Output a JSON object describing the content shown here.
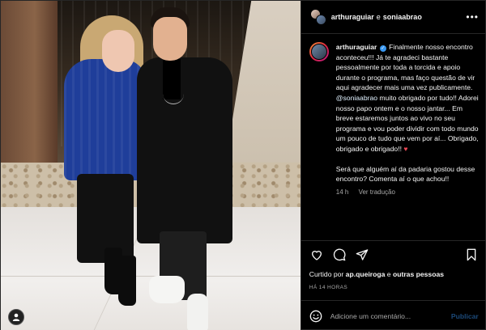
{
  "header": {
    "user1": "arthuraguiar",
    "connector": "e",
    "user2": "soniaabrao",
    "more_icon": "more-horizontal-icon"
  },
  "caption": {
    "author": "arthuraguiar",
    "part1": " Finalmente nosso encontro aconteceu!!! Já te agradeci bastante pessoalmente por toda a torcida e apoio durante o programa, mas faço questão de vir aqui agradecer mais uma vez publicamente. ",
    "mention": "@soniaabrao",
    "part2": " muito obrigado por tudo!! Adorei nosso papo ontem e o nosso jantar... Em breve estaremos juntos ao vivo no seu programa e vou poder dividir com todo mundo um pouco de tudo que vem por aí... Obrigado, obrigado e obrigado!! ",
    "heart": "♥",
    "paragraph2": "Será que alguém aí da padaria gostou desse encontro? Comenta aí o que achou!!",
    "age": "14 h",
    "translate": "Ver tradução"
  },
  "actions": {
    "like_icon": "heart-icon",
    "comment_icon": "comment-icon",
    "share_icon": "share-icon",
    "save_icon": "bookmark-icon"
  },
  "likes": {
    "prefix": "Curtido por ",
    "user": "ap.queiroga",
    "connector": " e ",
    "others": "outras pessoas"
  },
  "timestamp": "HÁ 14 HORAS",
  "comment": {
    "placeholder": "Adicione um comentário...",
    "publish_label": "Publicar"
  },
  "colors": {
    "background": "#000000",
    "verified": "#3897f0",
    "heart": "#ed4956",
    "publish_disabled": "#1c4a7a"
  }
}
